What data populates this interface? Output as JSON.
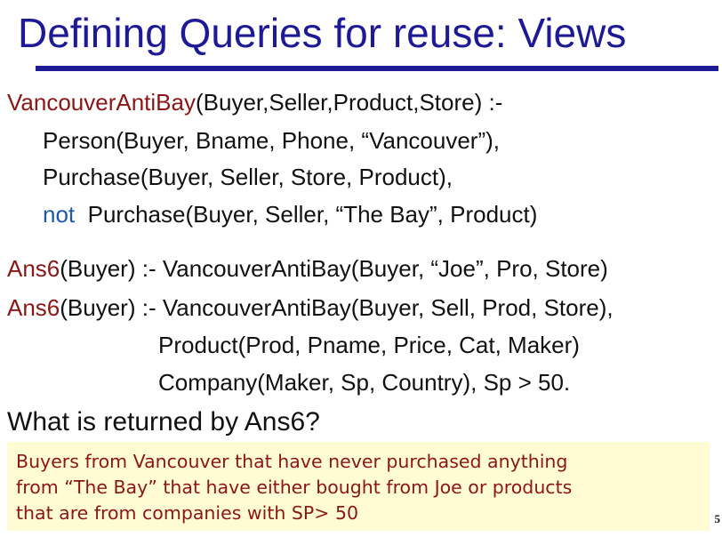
{
  "title": "Defining Queries for reuse: Views",
  "rule1": {
    "head_pred": "VancouverAntiBay",
    "head_args": "(Buyer,Seller,Product,Store) :-",
    "body1": "Person(Buyer, Bname, Phone, “Vancouver”),",
    "body2": "Purchase(Buyer, Seller, Store, Product),",
    "not_keyword": "not",
    "body3": "Purchase(Buyer, Seller, “The Bay”, Product)"
  },
  "rule2": {
    "head_pred": "Ans6",
    "rest": "(Buyer) :- VancouverAntiBay(Buyer, “Joe”, Pro, Store)"
  },
  "rule3": {
    "head_pred": "Ans6",
    "rest": "(Buyer) :- VancouverAntiBay(Buyer, Sell, Prod, Store),",
    "body2": "Product(Prod, Pname, Price, Cat, Maker)",
    "body3": "Company(Maker, Sp, Country), Sp > 50."
  },
  "question": "What is returned by Ans6?",
  "answer": "Buyers from Vancouver that have never purchased anything\n from “The Bay” that have either bought from Joe or products\nthat are from companies with SP> 50",
  "slide_number": "5",
  "colors": {
    "title": "#1e1a96",
    "predicate": "#8b1616",
    "not_keyword": "#1c5aa8",
    "answer_bg": "#fffbd3"
  }
}
